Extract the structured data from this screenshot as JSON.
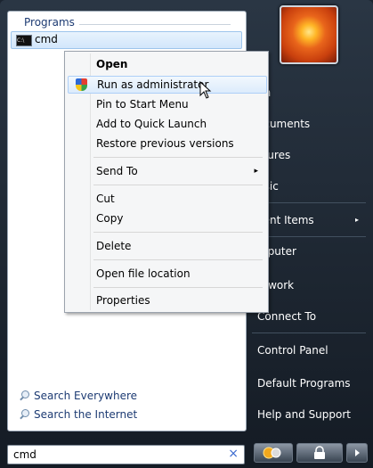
{
  "left": {
    "programs_header": "Programs",
    "result_item": "cmd",
    "search_links": [
      "Search Everywhere",
      "Search the Internet"
    ]
  },
  "search": {
    "value": "cmd",
    "clear": "×"
  },
  "right": {
    "items": [
      "hn",
      "ocuments",
      "ctures",
      "usic",
      "cent Items",
      "mputer",
      "etwork",
      "Connect To",
      "Control Panel",
      "Default Programs",
      "Help and Support"
    ],
    "arrow": "▸"
  },
  "context_menu": {
    "open": "Open",
    "run_as_admin": "Run as administrator",
    "pin_start": "Pin to Start Menu",
    "add_quick_launch": "Add to Quick Launch",
    "restore": "Restore previous versions",
    "send_to": "Send To",
    "cut": "Cut",
    "copy": "Copy",
    "delete": "Delete",
    "open_location": "Open file location",
    "properties": "Properties",
    "submenu_arrow": "▸"
  },
  "colors": {
    "highlight_border": "#aecff7",
    "accent": "#1d3b73"
  }
}
